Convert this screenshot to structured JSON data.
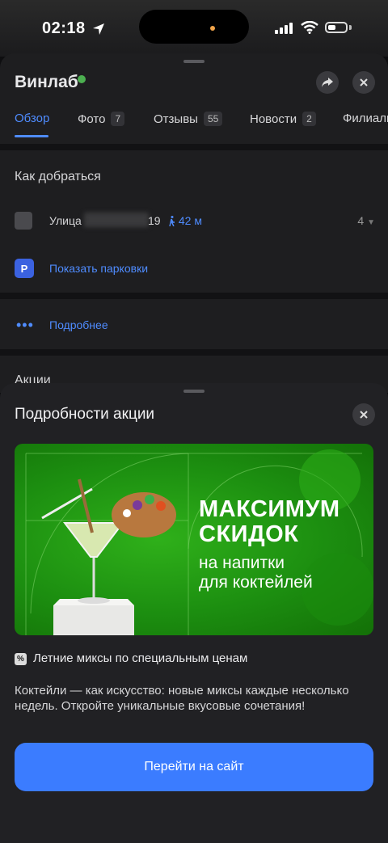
{
  "status_bar": {
    "time": "02:18"
  },
  "place": {
    "title": "Винлаб",
    "tabs": [
      {
        "label": "Обзор",
        "count": ""
      },
      {
        "label": "Фото",
        "count": "7"
      },
      {
        "label": "Отзывы",
        "count": "55"
      },
      {
        "label": "Новости",
        "count": "2"
      },
      {
        "label": "Филиалы",
        "count": ""
      }
    ],
    "directions": {
      "title": "Как добраться",
      "street_label": "Улица",
      "house": "19",
      "walk_distance": "42 м",
      "routes_count": "4",
      "show_parking": "Показать парковки",
      "parking_letter": "P"
    },
    "more_label": "Подробнее",
    "promotions_title": "Акции"
  },
  "promo_sheet": {
    "title": "Подробности акции",
    "banner": {
      "headline_line1": "МАКСИМУМ",
      "headline_line2": "СКИДОК",
      "sub_line1": "на напитки",
      "sub_line2": "для коктейлей"
    },
    "promo_name": "Летние миксы по специальным ценам",
    "description": "Коктейли — как искусство: новые миксы каждые несколько недель. Откройте уникальные вкусовые сочетания!",
    "cta_label": "Перейти на сайт"
  },
  "colors": {
    "accent": "#4f8cff",
    "cta": "#3b7cff",
    "promo_green": "#22a012"
  }
}
